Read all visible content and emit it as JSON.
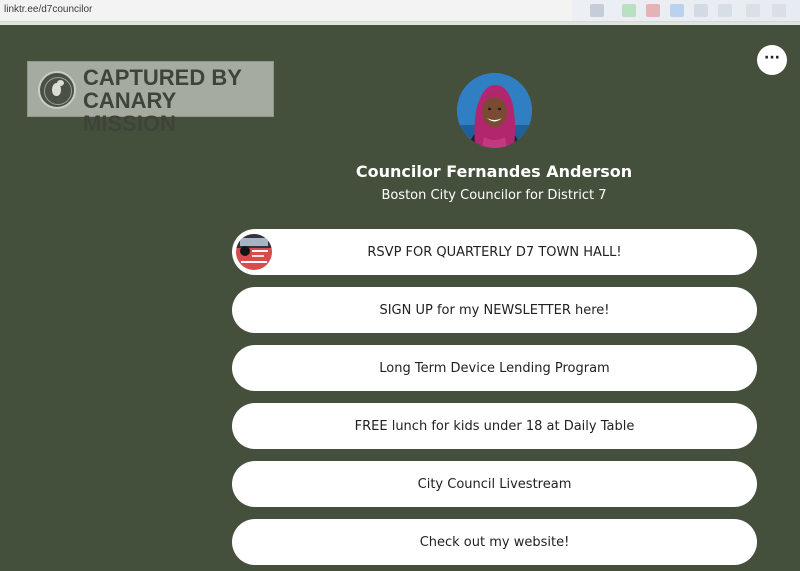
{
  "browser": {
    "url": "linktr.ee/d7councilor"
  },
  "watermark": {
    "line1": "CAPTURED BY",
    "line2": "CANARY MISSION"
  },
  "profile": {
    "name": "Councilor Fernandes Anderson",
    "title": "Boston City Councilor for District 7"
  },
  "menu": {
    "label": "···"
  },
  "links": [
    {
      "label": "RSVP FOR QUARTERLY D7 TOWN HALL!",
      "has_thumbnail": true
    },
    {
      "label": "SIGN UP for my NEWSLETTER here!"
    },
    {
      "label": "Long Term Device Lending Program"
    },
    {
      "label": "FREE lunch for kids under 18 at Daily Table"
    },
    {
      "label": "City Council Livestream"
    },
    {
      "label": "Check out my website!"
    }
  ],
  "colors": {
    "background": "#44503c",
    "button": "#ffffff",
    "text": "#222222"
  }
}
